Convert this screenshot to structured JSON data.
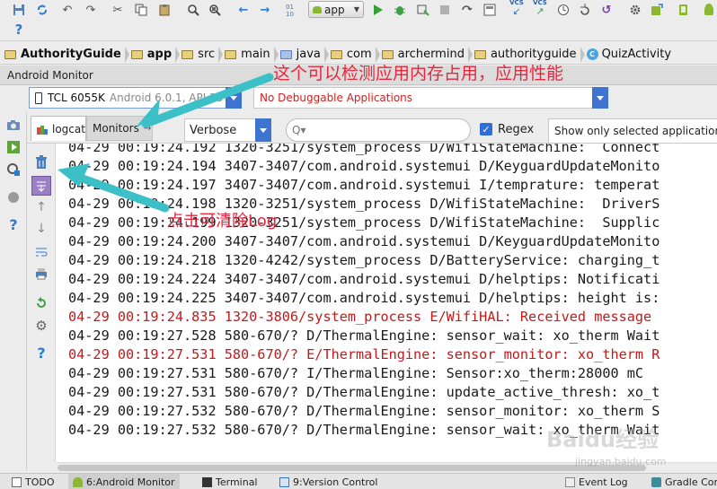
{
  "toolbar": {
    "run_config_label": "app",
    "vcs_label": "VCS",
    "icons": [
      "save-icon",
      "sync-icon",
      "help-icon",
      "undo-icon",
      "redo-icon",
      "cut-icon",
      "copy-icon",
      "paste-icon",
      "find-icon",
      "replace-icon",
      "back-icon",
      "forward-icon",
      "make-project-icon",
      "run-icon",
      "debug-icon",
      "attach-icon",
      "stop-icon",
      "apply-changes-icon",
      "vcs-update-icon",
      "vcs-commit-icon",
      "history-icon",
      "settings-icon",
      "sdk-manager-icon",
      "avd-manager-icon"
    ]
  },
  "breadcrumb": [
    {
      "label": "AuthorityGuide",
      "icon": "project-icon"
    },
    {
      "label": "app",
      "icon": "module-icon"
    },
    {
      "label": "src",
      "icon": "folder-icon"
    },
    {
      "label": "main",
      "icon": "folder-icon"
    },
    {
      "label": "java",
      "icon": "source-folder-icon"
    },
    {
      "label": "com",
      "icon": "package-icon"
    },
    {
      "label": "archermind",
      "icon": "package-icon"
    },
    {
      "label": "authorityguide",
      "icon": "package-icon"
    },
    {
      "label": "QuizActivity",
      "icon": "class-icon"
    }
  ],
  "panel": {
    "title": "Android Monitor",
    "device_name": "TCL 6055K",
    "device_sub": "Android 6.0.1, API 23",
    "process": "No Debuggable Applications"
  },
  "tabs": {
    "logcat": "logcat",
    "monitors": "Monitors",
    "monitors_suffix": "→"
  },
  "filters": {
    "level": "Verbose",
    "search_placeholder": "Q▾",
    "regex_checked": "✓",
    "regex_label": "Regex",
    "filter_option": "Show only selected application"
  },
  "log": {
    "lines": [
      {
        "text": "04-29 00:19:24.192 1320-3251/system_process D/WifiStateMachine:  Connect",
        "level": "D"
      },
      {
        "text": "04-29 00:19:24.194 3407-3407/com.android.systemui D/KeyguardUpdateMonito",
        "level": "D"
      },
      {
        "text": "04-29 00:19:24.197 3407-3407/com.android.systemui I/temprature: temperat",
        "level": "I"
      },
      {
        "text": "04-29 00:19:24.198 1320-3251/system_process D/WifiStateMachine:  DriverS",
        "level": "D"
      },
      {
        "text": "04-29 00:19:24.199 1320-3251/system_process D/WifiStateMachine:  Supplic",
        "level": "D"
      },
      {
        "text": "04-29 00:19:24.200 3407-3407/com.android.systemui D/KeyguardUpdateMonito",
        "level": "D"
      },
      {
        "text": "04-29 00:19:24.218 1320-4242/system_process D/BatteryService: charging_t",
        "level": "D"
      },
      {
        "text": "04-29 00:19:24.224 3407-3407/com.android.systemui D/helptips: Notificati",
        "level": "D"
      },
      {
        "text": "04-29 00:19:24.225 3407-3407/com.android.systemui D/helptips: height is:",
        "level": "D"
      },
      {
        "text": "04-29 00:19:24.835 1320-3806/system_process E/WifiHAL: Received message ",
        "level": "E"
      },
      {
        "text": "04-29 00:19:27.528 580-670/? D/ThermalEngine: sensor_wait: xo_therm Wait",
        "level": "D"
      },
      {
        "text": "04-29 00:19:27.531 580-670/? E/ThermalEngine: sensor_monitor: xo_therm R",
        "level": "E"
      },
      {
        "text": "04-29 00:19:27.531 580-670/? I/ThermalEngine: Sensor:xo_therm:28000 mC",
        "level": "I"
      },
      {
        "text": "04-29 00:19:27.531 580-670/? D/ThermalEngine: update_active_thresh: xo_t",
        "level": "D"
      },
      {
        "text": "04-29 00:19:27.532 580-670/? D/ThermalEngine: sensor_monitor: xo_therm S",
        "level": "D"
      },
      {
        "text": "04-29 00:19:27.532 580-670/? D/ThermalEngine: sensor_wait: xo_therm Wait",
        "level": "D"
      }
    ]
  },
  "bottom_tabs": [
    {
      "label": "TODO",
      "prefix": ""
    },
    {
      "label": "Android Monitor",
      "prefix": "6: "
    },
    {
      "label": "Terminal",
      "prefix": ""
    },
    {
      "label": "Version Control",
      "prefix": "9: "
    },
    {
      "label": "Event Log",
      "prefix": ""
    },
    {
      "label": "Gradle Cons",
      "prefix": ""
    }
  ],
  "annotations": {
    "monitor_note": "这个可以检测应用内存占用，应用性能",
    "clear_note": "点击可清除Log"
  },
  "watermark": {
    "text": "Baidu经验",
    "sub": "jingyan.baidu.com"
  },
  "colors": {
    "accent_blue": "#3e74d0",
    "error_red": "#c01a1a",
    "annotation_red": "#e6273d",
    "arrow_cyan": "#3cc0c8"
  }
}
